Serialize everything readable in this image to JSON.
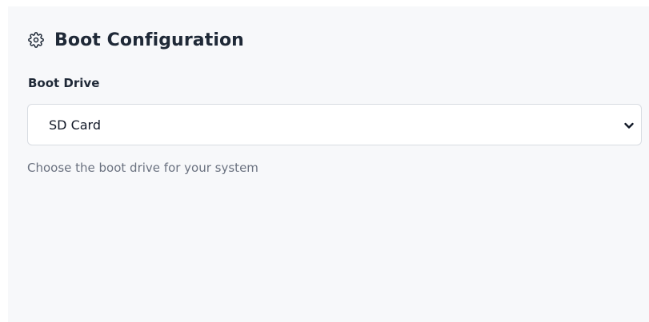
{
  "section": {
    "title": "Boot Configuration",
    "icon": "gear-icon"
  },
  "boot_drive": {
    "label": "Boot Drive",
    "selected": "SD Card",
    "help_text": "Choose the boot drive for your system"
  },
  "colors": {
    "panel_bg": "#f7f8fa",
    "title_text": "#1f2937",
    "help_text": "#6b7280",
    "field_border": "#d8dce2"
  }
}
